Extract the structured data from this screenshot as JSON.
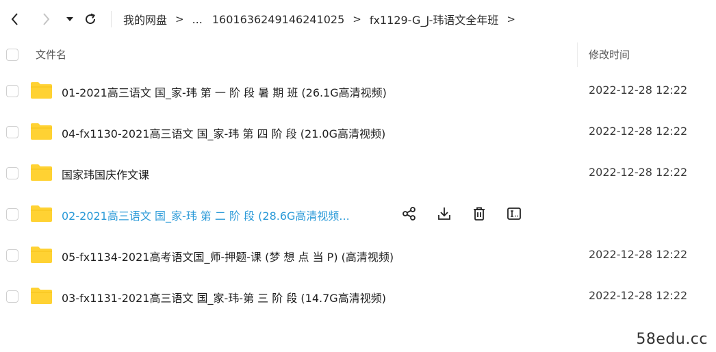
{
  "toolbar": {
    "back_icon": "chevron-left-icon",
    "forward_icon": "chevron-right-icon",
    "history_icon": "caret-down-icon",
    "refresh_icon": "refresh-icon"
  },
  "breadcrumb": {
    "items": [
      "我的网盘",
      "...",
      "1601636249146241025",
      "fx1129-G_J-玮语文全年班"
    ],
    "separator": ">"
  },
  "header": {
    "name_label": "文件名",
    "time_label": "修改时间"
  },
  "files": [
    {
      "name": "01-2021高三语文 国_家-玮 第 一 阶 段 暑 期 班 (26.1G高清视频)",
      "time": "2022-12-28 12:22"
    },
    {
      "name": "04-fx1130-2021高三语文 国_家-玮 第 四 阶 段 (21.0G高清视频)",
      "time": "2022-12-28 12:22"
    },
    {
      "name": "国家玮国庆作文课",
      "time": "2022-12-28 12:22"
    },
    {
      "name": "02-2021高三语文 国_家-玮 第 二 阶 段 (28.6G高清视频...",
      "time": ""
    },
    {
      "name": "05-fx1134-2021高考语文国_师-押题-课 (梦 想 点 当 P)  (高清视频)",
      "time": "2022-12-28 12:22"
    },
    {
      "name": "03-fx1131-2021高三语文 国_家-玮-第 三 阶 段 (14.7G高清视频)",
      "time": "2022-12-28 12:22"
    }
  ],
  "row_actions": [
    "share-icon",
    "download-icon",
    "delete-icon",
    "rename-icon"
  ],
  "colors": {
    "folder": "#ffd233",
    "hover_text": "#2b9ad8"
  },
  "watermark": "58edu.cc"
}
